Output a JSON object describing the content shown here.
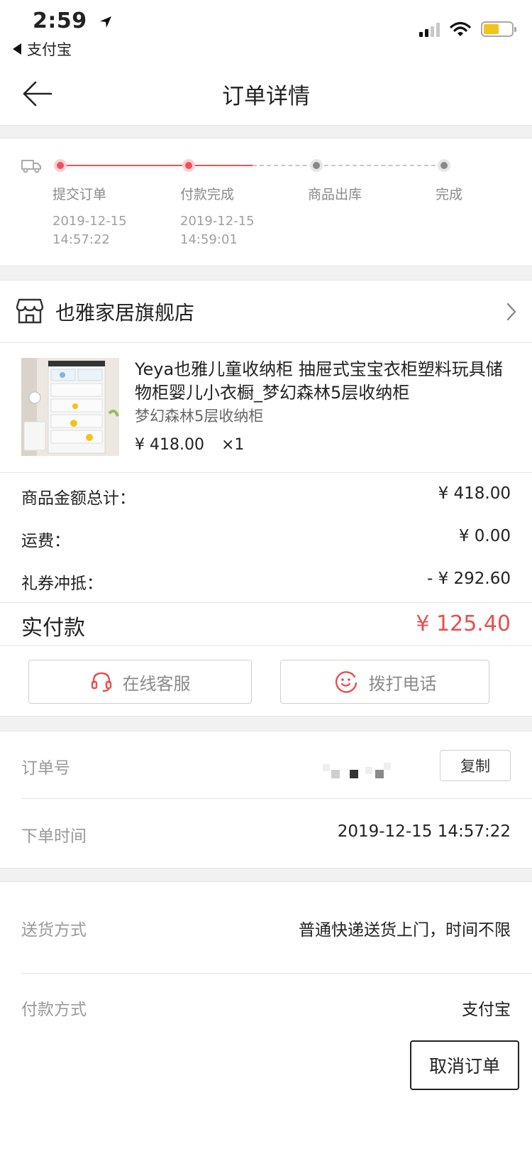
{
  "status_bar": {
    "time": "2:59",
    "back_app": "支付宝"
  },
  "nav": {
    "title": "订单详情"
  },
  "progress": {
    "steps": [
      {
        "label": "提交订单",
        "date": "2019-12-15\n14:57:22",
        "state": "done"
      },
      {
        "label": "付款完成",
        "date": "2019-12-15\n14:59:01",
        "state": "done"
      },
      {
        "label": "商品出库",
        "date": "",
        "state": "pending"
      },
      {
        "label": "完成",
        "date": "",
        "state": "pending"
      }
    ]
  },
  "store": {
    "name": "也雅家居旗舰店"
  },
  "product": {
    "title": "Yeya也雅儿童收纳柜 抽屉式宝宝衣柜塑料玩具储物柜婴儿小衣橱_梦幻森林5层收纳柜",
    "spec": "梦幻森林5层收纳柜",
    "price": "¥ 418.00",
    "quantity": "×1"
  },
  "amounts": {
    "subtotal_label": "商品金额总计：",
    "subtotal_value": "¥ 418.00",
    "shipping_label": "运费：",
    "shipping_value": "¥ 0.00",
    "coupon_label": "礼券冲抵：",
    "coupon_value": "- ¥ 292.60",
    "paid_label": "实付款",
    "paid_value": "¥ 125.40"
  },
  "actions": {
    "service_label": "在线客服",
    "call_label": "拨打电话"
  },
  "order_info": {
    "order_no_label": "订单号",
    "copy_label": "复制",
    "order_time_label": "下单时间",
    "order_time_value": "2019-12-15 14:57:22",
    "delivery_label": "送货方式",
    "delivery_value": "普通快递送货上门，时间不限",
    "payment_label": "付款方式",
    "payment_value": "支付宝"
  },
  "footer": {
    "cancel_label": "取消订单"
  },
  "colors": {
    "accent_red": "#e94e4e",
    "progress_red": "#f0505c",
    "battery_yellow": "#f2c31a"
  }
}
